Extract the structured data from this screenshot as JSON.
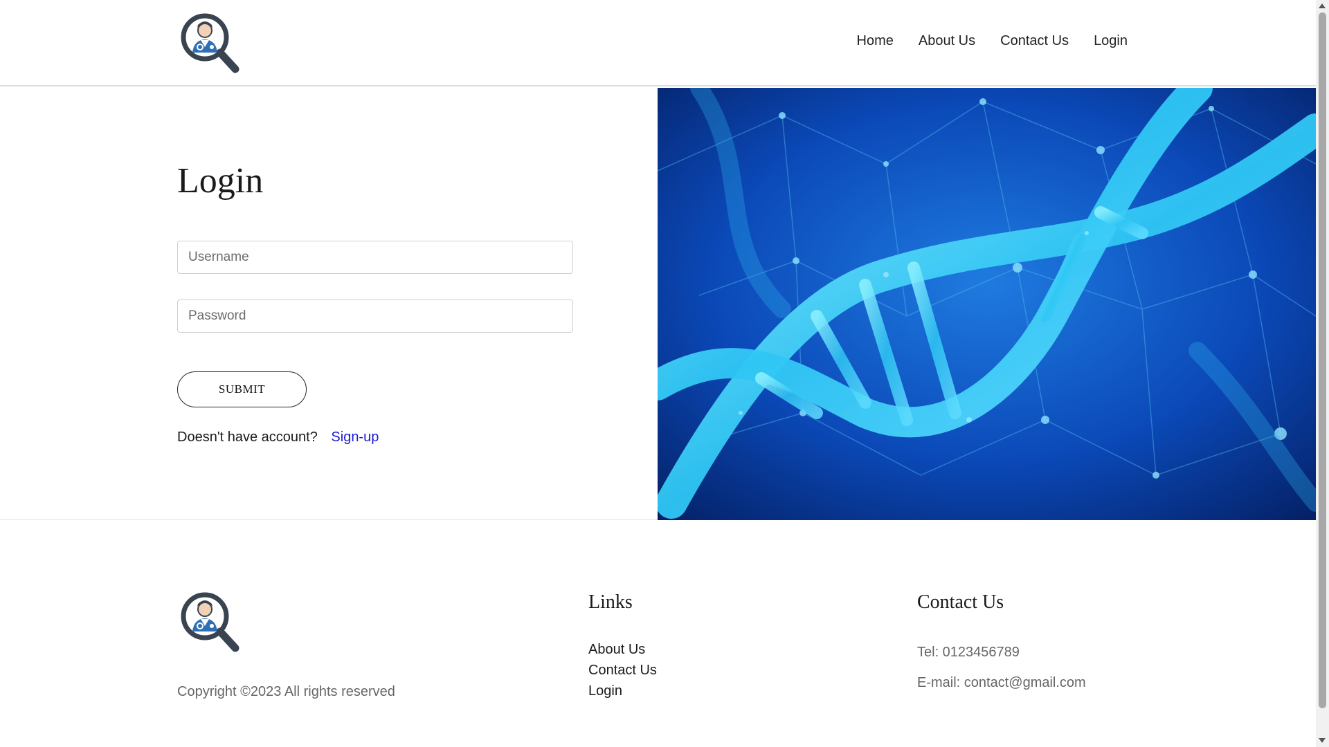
{
  "header": {
    "logo_icon": "doctor-magnifier-logo",
    "nav": [
      {
        "label": "Home"
      },
      {
        "label": "About Us"
      },
      {
        "label": "Contact Us"
      },
      {
        "label": "Login"
      }
    ]
  },
  "login": {
    "title": "Login",
    "username_placeholder": "Username",
    "password_placeholder": "Password",
    "submit_label": "SUBMIT",
    "no_account_text": "Doesn't have account?",
    "signup_label": "Sign-up"
  },
  "hero": {
    "image_icon": "dna-helix-image"
  },
  "footer": {
    "copyright": "Copyright ©2023 All rights reserved",
    "links_title": "Links",
    "links": [
      {
        "label": "About Us"
      },
      {
        "label": "Contact Us"
      },
      {
        "label": "Login"
      }
    ],
    "contact_title": "Contact Us",
    "tel": "Tel: 0123456789",
    "email": "E-mail: contact@gmail.com"
  },
  "colors": {
    "link_blue": "#1a1ad6",
    "hero_blue": "#0a4fc4",
    "logo_dark": "#3a4350"
  }
}
